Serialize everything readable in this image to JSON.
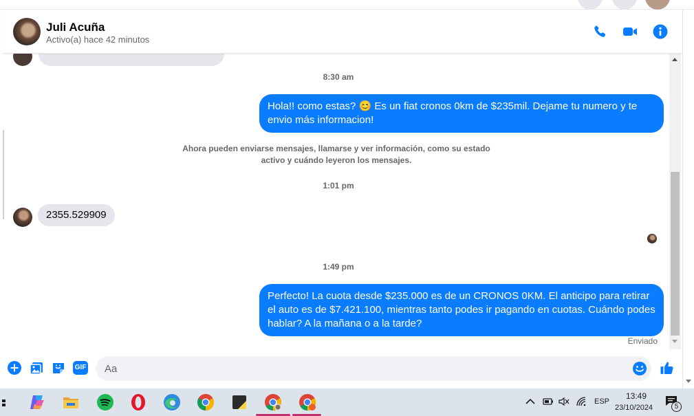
{
  "contact": {
    "name": "Juli Acuña",
    "status": "Activo(a) hace 42 minutos"
  },
  "header_icons": [
    "phone-icon",
    "video-icon",
    "info-icon"
  ],
  "messages": {
    "t1": "8:30 am",
    "out1": "Hola!! como estas? 😊 Es un fiat cronos 0km de $235mil. Dejame tu numero y te envio más informacion!",
    "system": "Ahora pueden enviarse mensajes, llamarse y ver información, como su estado activo y cuándo leyeron los mensajes.",
    "t2": "1:01 pm",
    "in1": "2355.529909",
    "t3": "1:49 pm",
    "out2": "Perfecto! La cuota desde $235.000 es de un CRONOS 0KM. El anticipo para retirar el auto es de $7.421.100, mientras tanto podes ir pagando en cuotas. Cuándo podes hablar? A la mañana o a la tarde?",
    "sent_label": "Enviado"
  },
  "composer": {
    "placeholder": "Aa",
    "gif_label": "GIF"
  },
  "colors": {
    "accent": "#0a7cff",
    "bubble_in": "#e4e6eb",
    "taskbar": "#dde3ea"
  },
  "taskbar": {
    "apps": [
      "copilot-icon",
      "file-explorer-icon",
      "spotify-icon",
      "opera-icon",
      "edge-icon",
      "chrome-icon",
      "sticky-notes-icon",
      "chrome-profile-icon",
      "chrome-profile-2-icon"
    ],
    "language": "ESP",
    "time": "13:49",
    "date": "23/10/2024",
    "notifications": "5"
  }
}
